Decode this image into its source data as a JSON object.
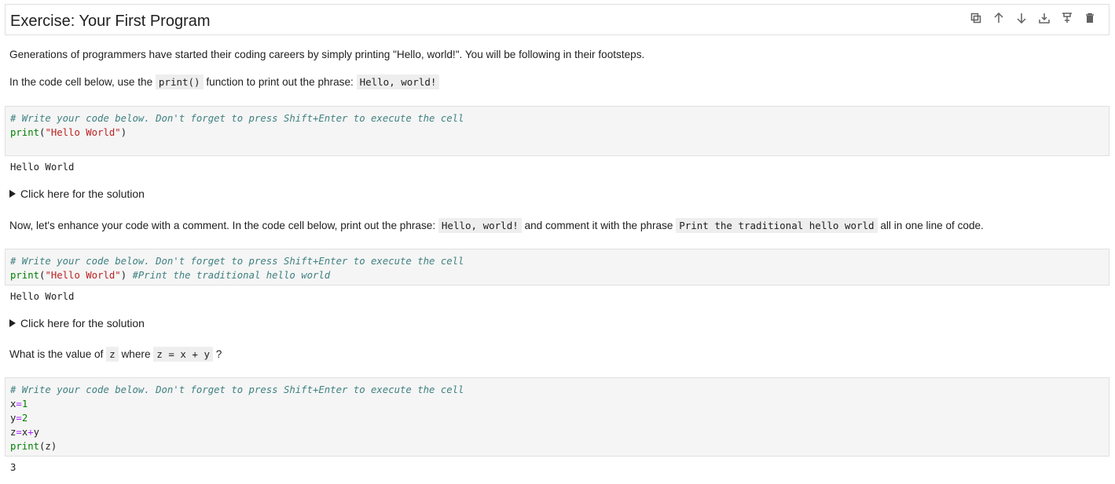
{
  "header": {
    "title": "Exercise: Your First Program",
    "toolbar": [
      "duplicate-icon",
      "move-up-icon",
      "move-down-icon",
      "insert-above-icon",
      "insert-below-icon",
      "delete-icon"
    ]
  },
  "p1": "Generations of programmers have started their coding careers by simply printing \"Hello, world!\". You will be following in their footsteps.",
  "p2": {
    "a": "In the code cell below, use the ",
    "code1": "print()",
    "b": " function to print out the phrase: ",
    "code2": "Hello, world!"
  },
  "cell1": {
    "comment": "# Write your code below. Don't forget to press Shift+Enter to execute the cell",
    "fn": "print",
    "open": "(",
    "str": "\"Hello World\"",
    "close": ")",
    "output": "Hello World"
  },
  "solution1": "Click here for the solution",
  "p3": {
    "a": "Now, let's enhance your code with a comment. In the code cell below, print out the phrase: ",
    "code1": "Hello, world!",
    "b": " and comment it with the phrase ",
    "code2": "Print the traditional hello world",
    "c": " all in one line of code."
  },
  "cell2": {
    "comment": "# Write your code below. Don't forget to press Shift+Enter to execute the cell",
    "fn": "print",
    "open": "(",
    "str": "\"Hello World\"",
    "close": ") ",
    "inline_comment": "#Print the traditional hello world",
    "output": "Hello World"
  },
  "solution2": "Click here for the solution",
  "p4": {
    "a": "What is the value of ",
    "code1": "z",
    "b": " where ",
    "code2": "z = x + y",
    "c": " ?"
  },
  "cell3": {
    "comment": "# Write your code below. Don't forget to press Shift+Enter to execute the cell",
    "l1_var": "x",
    "l1_op": "=",
    "l1_num": "1",
    "l2_var": "y",
    "l2_op": "=",
    "l2_num": "2",
    "l3_a": "z",
    "l3_op1": "=",
    "l3_b": "x",
    "l3_op2": "+",
    "l3_c": "y",
    "l4_fn": "print",
    "l4_arg": "(z)",
    "output": "3"
  }
}
